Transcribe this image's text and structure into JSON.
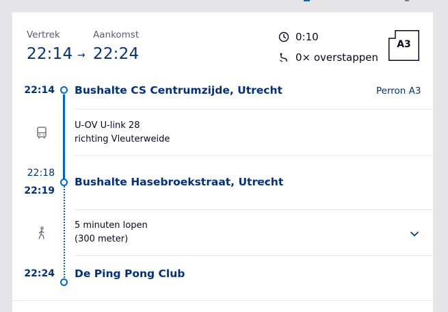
{
  "summary": {
    "departure_label": "Vertrek",
    "arrival_label": "Aankomst",
    "departure_time": "22:14",
    "arrow": "→",
    "arrival_time": "22:24",
    "duration": "0:10",
    "transfers": "0× overstappen",
    "platform_badge": "A3"
  },
  "timeline": {
    "stop1": {
      "time": "22:14",
      "name": "Bushalte CS Centrumzijde, Utrecht",
      "platform": "Perron A3"
    },
    "leg1": {
      "icon": "bus-icon",
      "line": "U-OV U-link 28",
      "direction": "richting Vleuterweide"
    },
    "stop2": {
      "arrival_time": "22:18",
      "departure_time": "22:19",
      "name": "Bushalte Hasebroekstraat, Utrecht",
      "more": "···"
    },
    "leg2": {
      "icon": "walking-icon",
      "line": "5 minuten lopen",
      "detail": "(300 meter)"
    },
    "stop3": {
      "time": "22:24",
      "name": "De Ping Pong Club"
    }
  },
  "colors": {
    "brand_blue": "#003082",
    "accent_blue": "#0063d3",
    "divider": "#e6e6e9"
  }
}
